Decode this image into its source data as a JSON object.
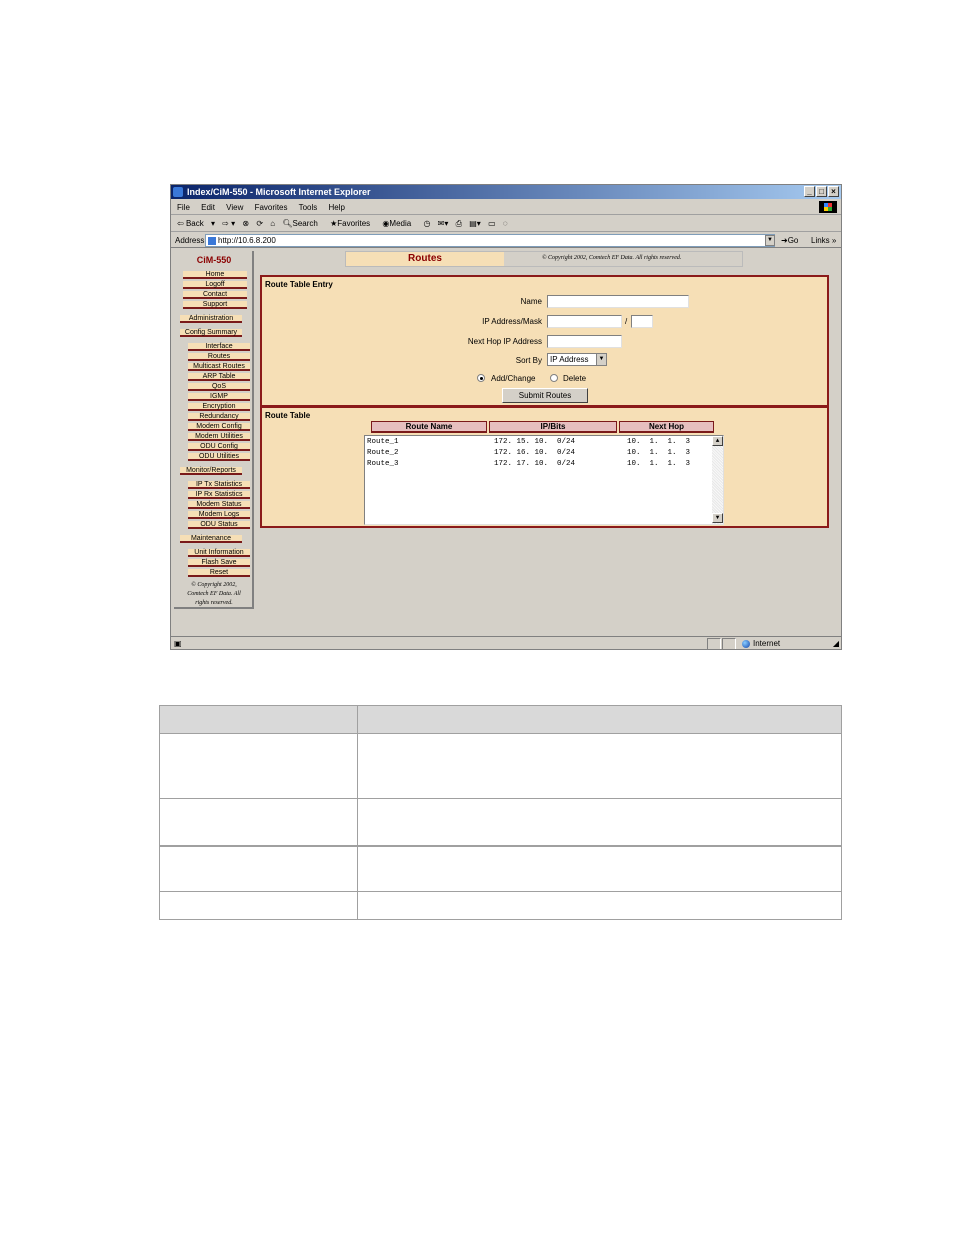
{
  "window": {
    "title": "Index/CiM-550 - Microsoft Internet Explorer",
    "menu": [
      "File",
      "Edit",
      "View",
      "Favorites",
      "Tools",
      "Help"
    ],
    "toolbar": [
      "Back",
      "Search",
      "Favorites",
      "Media"
    ],
    "address_label": "Address",
    "address_url": "http://10.6.8.200",
    "go_label": "Go",
    "links_label": "Links",
    "status_zone": "Internet"
  },
  "sidebar": {
    "title": "CiM-550",
    "top_items": [
      "Home",
      "Logoff",
      "Contact",
      "Support"
    ],
    "sections": [
      {
        "label": "Administration",
        "items": []
      },
      {
        "label": "Config Summary",
        "items": [
          "Interface",
          "Routes",
          "Multicast Routes",
          "ARP Table",
          "QoS",
          "IGMP",
          "Encryption",
          "Redundancy",
          "Modem Config",
          "Modem Utilities",
          "ODU Config",
          "ODU Utilities"
        ]
      },
      {
        "label": "Monitor/Reports",
        "items": [
          "IP Tx Statistics",
          "IP Rx Statistics",
          "Modem Status",
          "Modem Logs",
          "ODU Status"
        ]
      },
      {
        "label": "Maintenance",
        "items": [
          "Unit Information",
          "Flash Save",
          "Reset"
        ]
      }
    ],
    "copyright": "© Copyright 2002, Comtech EF Data. All rights reserved."
  },
  "header": {
    "page_title": "Routes",
    "copyright": "© Copyright 2002, Comtech EF Data. All rights reserved."
  },
  "entry": {
    "title": "Route Table Entry",
    "name_label": "Name",
    "ip_label": "IP Address/Mask",
    "slash": "/",
    "nexthop_label": "Next Hop IP Address",
    "sortby_label": "Sort By",
    "sortby_value": "IP Address",
    "radio_add": "Add/Change",
    "radio_delete": "Delete",
    "submit_label": "Submit Routes"
  },
  "route_table": {
    "title": "Route Table",
    "columns": [
      "Route Name",
      "IP/Bits",
      "Next Hop"
    ],
    "rows": [
      [
        "Route_1",
        "172. 15. 10.  0/24",
        "10.  1.  1.  3"
      ],
      [
        "Route_2",
        "172. 16. 10.  0/24",
        "10.  1.  1.  3"
      ],
      [
        "Route_3",
        "172. 17. 10.  0/24",
        "10.  1.  1.  3"
      ]
    ]
  }
}
